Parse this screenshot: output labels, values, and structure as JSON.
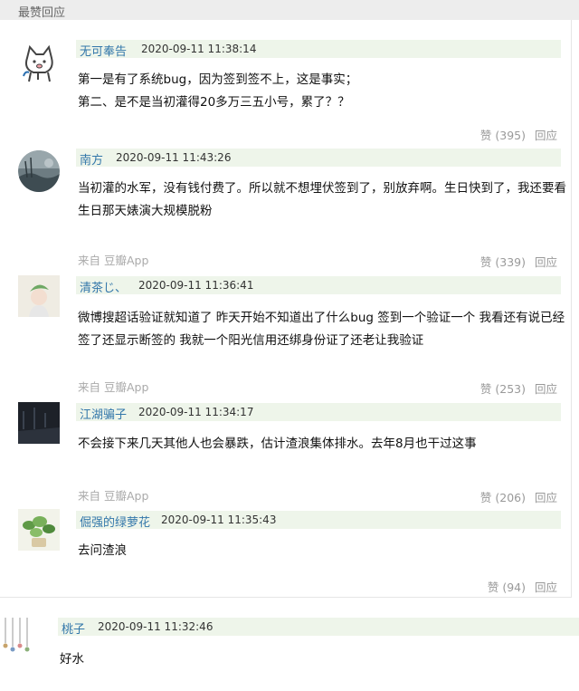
{
  "header": {
    "title": "最赞回应"
  },
  "comments": [
    {
      "author": "无可奉告",
      "time": "2020-09-11 11:38:14",
      "lines": [
        "第一是有了系统bug，因为签到签不上，这是事实；",
        "第二、是不是当初灌得20多万三五小号，累了？？"
      ],
      "source": "",
      "likes": "赞 (395)",
      "reply": "回应"
    },
    {
      "author": "南方",
      "time": "2020-09-11 11:43:26",
      "lines": [
        "当初灌的水军，没有钱付费了。所以就不想埋伏签到了，别放弃啊。生日快到了，我还要看",
        "生日那天婊演大规模脱粉"
      ],
      "source": "来自 豆瓣App",
      "likes": "赞 (339)",
      "reply": "回应"
    },
    {
      "author": "清茶じ、",
      "time": "2020-09-11 11:36:41",
      "lines": [
        "微博搜超话验证就知道了 昨天开始不知道出了什么bug 签到一个验证一个 我看还有说已经",
        "签了还显示断签的 我就一个阳光信用还绑身份证了还老让我验证"
      ],
      "source": "来自 豆瓣App",
      "likes": "赞 (253)",
      "reply": "回应"
    },
    {
      "author": "江湖骗子",
      "time": "2020-09-11 11:34:17",
      "lines": [
        "不会接下来几天其他人也会暴跌，估计渣浪集体排水。去年8月也干过这事"
      ],
      "source": "来自 豆瓣App",
      "likes": "赞 (206)",
      "reply": "回应"
    },
    {
      "author": "倔强的绿萝花",
      "time": "2020-09-11 11:35:43",
      "lines": [
        "去问渣浪"
      ],
      "source": "",
      "likes": "赞 (94)",
      "reply": "回应"
    },
    {
      "author": "桃子",
      "time": "2020-09-11 11:32:46",
      "lines": [
        "好水"
      ],
      "source": "",
      "likes": "",
      "reply": ""
    }
  ],
  "avatars": [
    {
      "icon": "cat-cartoon-icon",
      "color": "#444444"
    },
    {
      "icon": "landscape-photo-icon",
      "color": "#5b6b73"
    },
    {
      "icon": "girl-leaf-hat-icon",
      "color": "#7aa37a"
    },
    {
      "icon": "dark-scene-icon",
      "color": "#1e232a"
    },
    {
      "icon": "green-plant-icon",
      "color": "#6fa45a"
    },
    {
      "icon": "hanging-charms-icon",
      "color": "#888888"
    }
  ]
}
